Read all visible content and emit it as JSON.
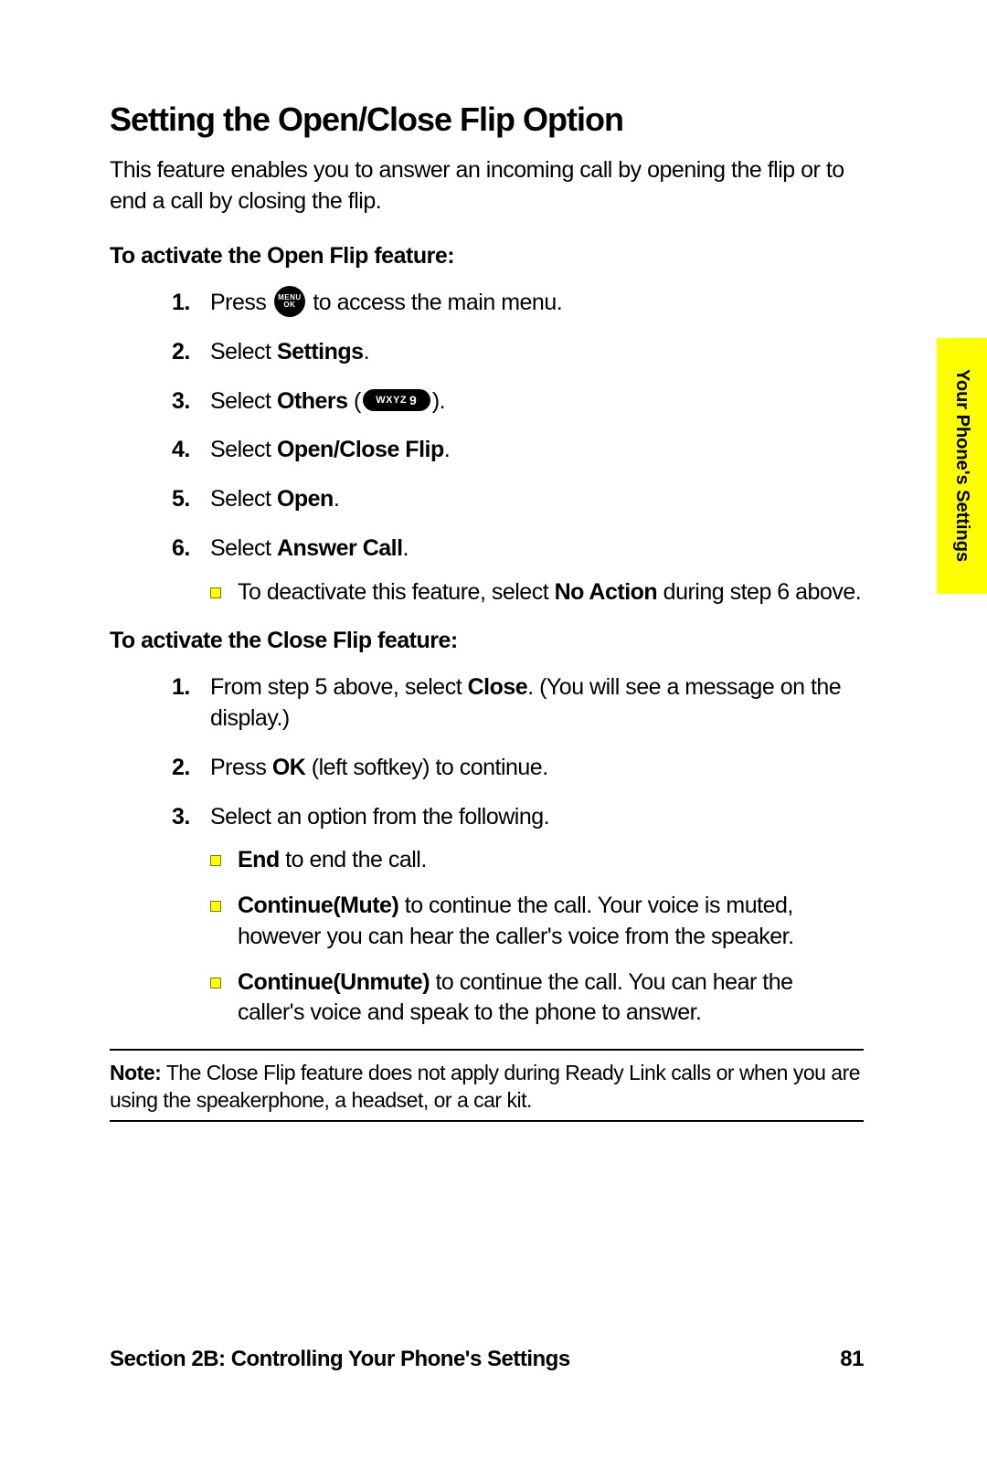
{
  "sideTab": "Your Phone's Settings",
  "heading": "Setting the Open/Close Flip Option",
  "intro": "This feature enables you to answer an incoming call by opening the flip or to end a call by closing the flip.",
  "sectionA": {
    "title": "To activate the Open Flip feature:",
    "steps": {
      "s1_a": "Press",
      "s1_b": "to access the main menu.",
      "s2_a": "Select ",
      "s2_b": "Settings",
      "s2_c": ".",
      "s3_a": "Select ",
      "s3_b": "Others",
      "s3_c": " (",
      "s3_d": ").",
      "s4_a": "Select ",
      "s4_b": "Open/Close Flip",
      "s4_c": ".",
      "s5_a": "Select ",
      "s5_b": "Open",
      "s5_c": ".",
      "s6_a": "Select ",
      "s6_b": "Answer Call",
      "s6_c": ".",
      "s6_sub_a": "To deactivate this feature, select ",
      "s6_sub_b": "No Action",
      "s6_sub_c": " during step 6 above."
    }
  },
  "sectionB": {
    "title": "To activate the Close Flip feature:",
    "steps": {
      "s1_a": "From step 5 above, select ",
      "s1_b": "Close",
      "s1_c": ". (You will see a message on the display.)",
      "s2_a": "Press ",
      "s2_b": "OK",
      "s2_c": " (left softkey) to continue.",
      "s3": "Select an option from the following.",
      "s3_sub1_b": "End",
      "s3_sub1_c": " to end the call.",
      "s3_sub2_b": "Continue(Mute)",
      "s3_sub2_c": " to continue the call. Your voice is muted, however you can hear the caller's voice from the speaker.",
      "s3_sub3_b": "Continue(Unmute)",
      "s3_sub3_c": " to continue the call. You can hear the caller's voice and speak to the phone to answer."
    }
  },
  "note_label": "Note:",
  "note_text": " The Close Flip feature does not apply during Ready Link calls or when you are using the speakerphone, a headset, or a car kit.",
  "footer_section": "Section 2B: Controlling Your Phone's Settings",
  "footer_page": "81",
  "icons": {
    "menu_top": "MENU",
    "menu_bot": "OK",
    "key_letters": "WXYZ",
    "key_digit": "9"
  },
  "nums": {
    "n1": "1.",
    "n2": "2.",
    "n3": "3.",
    "n4": "4.",
    "n5": "5.",
    "n6": "6."
  }
}
